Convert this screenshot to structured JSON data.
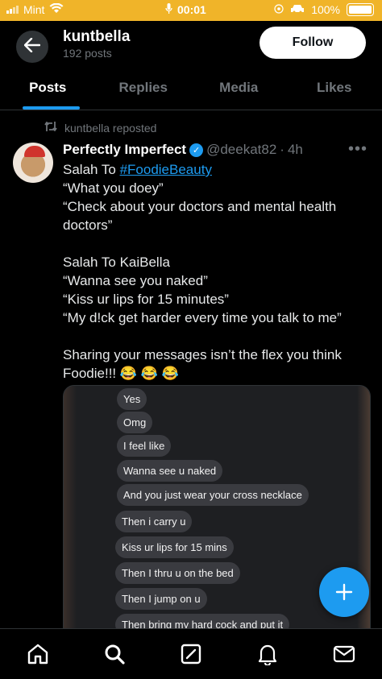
{
  "status_bar": {
    "carrier": "Mint",
    "time": "00:01",
    "battery": "100%"
  },
  "header": {
    "title": "kuntbella",
    "subtitle": "192 posts",
    "follow_label": "Follow"
  },
  "tabs": [
    {
      "label": "Posts",
      "active": true
    },
    {
      "label": "Replies"
    },
    {
      "label": "Media"
    },
    {
      "label": "Likes"
    }
  ],
  "post": {
    "repost_label": "kuntbella reposted",
    "author_name": "Perfectly Imperfect",
    "handle": "@deekat82",
    "separator": "·",
    "time": "4h",
    "lines": [
      {
        "prefix": "Salah To ",
        "hashtag": "#FoodieBeauty"
      },
      "“What you doey”",
      "“Check about your doctors and mental health doctors”",
      "",
      "Salah To KaiBella",
      "“Wanna see you naked”",
      "“Kiss ur lips for 15 minutes”",
      "“My d!ck get harder every time you talk to me”",
      "",
      "Sharing your messages isn’t the flex you think Foodie!!! 😂 😂 😂"
    ]
  },
  "chat_bubbles": [
    "Yes",
    "Omg",
    "I feel like",
    "Wanna see u naked",
    "And you just wear your cross necklace",
    "Then i carry u",
    "Kiss ur lips for 15 mins",
    "Then I thru u on the bed",
    "Then I jump on u",
    "Then bring my hard cock and put it"
  ],
  "colors": {
    "accent": "#1d9bf0",
    "status_bar": "#f0b429",
    "background": "#000000"
  },
  "icons": [
    "back-arrow-icon",
    "repost-icon",
    "verified-icon",
    "more-icon",
    "compose-plus-icon",
    "home-icon",
    "search-icon",
    "grok-icon",
    "notifications-icon",
    "messages-icon"
  ]
}
